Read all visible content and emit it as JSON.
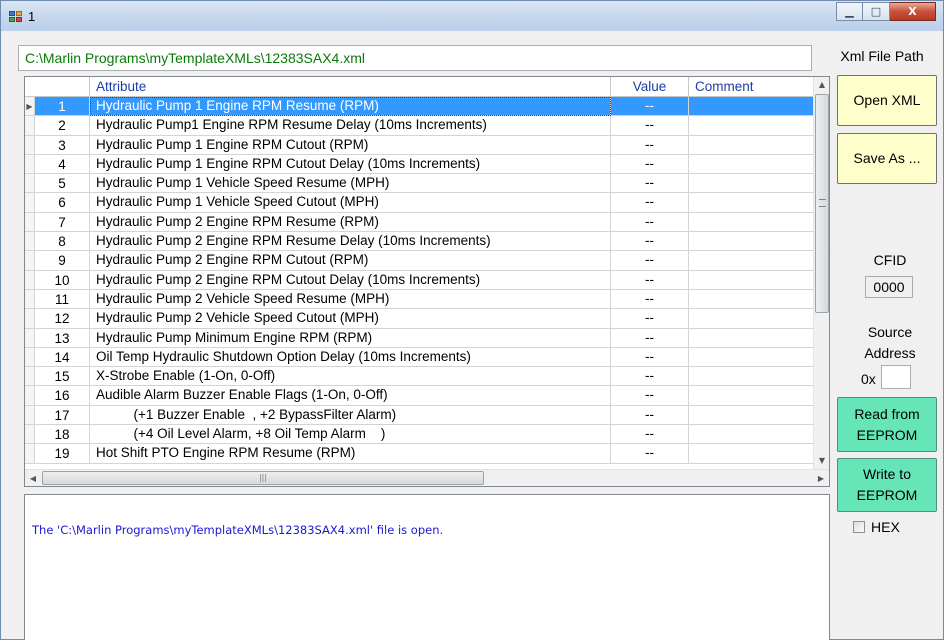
{
  "window": {
    "title": "1",
    "min_symbol": "▁",
    "max_symbol": "□",
    "close_symbol": "X"
  },
  "path": {
    "value": "C:\\Marlin Programs\\myTemplateXMLs\\12383SAX4.xml",
    "label": "Xml File Path"
  },
  "grid": {
    "columns": [
      "Attribute",
      "Value",
      "Comment"
    ],
    "selected_row": 0,
    "rows": [
      {
        "num": "1",
        "attr": "Hydraulic Pump 1 Engine RPM Resume (RPM)",
        "value": "--",
        "comment": ""
      },
      {
        "num": "2",
        "attr": "Hydraulic Pump1 Engine RPM Resume Delay (10ms Increments)",
        "value": "--",
        "comment": ""
      },
      {
        "num": "3",
        "attr": "Hydraulic Pump 1 Engine RPM Cutout (RPM)",
        "value": "--",
        "comment": ""
      },
      {
        "num": "4",
        "attr": "Hydraulic Pump 1 Engine RPM Cutout Delay (10ms Increments)",
        "value": "--",
        "comment": ""
      },
      {
        "num": "5",
        "attr": "Hydraulic Pump 1 Vehicle Speed Resume (MPH)",
        "value": "--",
        "comment": ""
      },
      {
        "num": "6",
        "attr": "Hydraulic Pump 1 Vehicle Speed Cutout (MPH)",
        "value": "--",
        "comment": ""
      },
      {
        "num": "7",
        "attr": "Hydraulic Pump 2 Engine RPM Resume (RPM)",
        "value": "--",
        "comment": ""
      },
      {
        "num": "8",
        "attr": "Hydraulic Pump 2 Engine RPM Resume Delay (10ms Increments)",
        "value": "--",
        "comment": ""
      },
      {
        "num": "9",
        "attr": "Hydraulic Pump 2 Engine RPM Cutout (RPM)",
        "value": "--",
        "comment": ""
      },
      {
        "num": "10",
        "attr": "Hydraulic Pump 2 Engine RPM Cutout Delay (10ms Increments)",
        "value": "--",
        "comment": ""
      },
      {
        "num": "11",
        "attr": "Hydraulic Pump 2 Vehicle Speed Resume (MPH)",
        "value": "--",
        "comment": ""
      },
      {
        "num": "12",
        "attr": "Hydraulic Pump 2 Vehicle Speed Cutout (MPH)",
        "value": "--",
        "comment": ""
      },
      {
        "num": "13",
        "attr": "Hydraulic Pump Minimum Engine RPM (RPM)",
        "value": "--",
        "comment": ""
      },
      {
        "num": "14",
        "attr": "Oil Temp Hydraulic Shutdown Option Delay (10ms Increments)",
        "value": "--",
        "comment": ""
      },
      {
        "num": "15",
        "attr": "X-Strobe Enable (1-On, 0-Off)",
        "value": "--",
        "comment": ""
      },
      {
        "num": "16",
        "attr": "Audible Alarm Buzzer Enable Flags (1-On, 0-Off)",
        "value": "--",
        "comment": ""
      },
      {
        "num": "17",
        "attr": "          (+1 Buzzer Enable  , +2 BypassFilter Alarm)",
        "value": "--",
        "comment": ""
      },
      {
        "num": "18",
        "attr": "          (+4 Oil Level Alarm, +8 Oil Temp Alarm    )",
        "value": "--",
        "comment": ""
      },
      {
        "num": "19",
        "attr": "Hot Shift PTO Engine RPM Resume (RPM)",
        "value": "--",
        "comment": ""
      }
    ]
  },
  "log": {
    "message": "The 'C:\\Marlin Programs\\myTemplateXMLs\\12383SAX4.xml' file is open."
  },
  "panel": {
    "open_xml": "Open XML",
    "save_as": "Save As ...",
    "cfid_label": "CFID",
    "cfid_value": "0000",
    "source_label_1": "Source",
    "source_label_2": "Address",
    "ox_prefix": "0x",
    "source_value": "",
    "read_1": "Read from",
    "read_2": "EEPROM",
    "write_1": "Write to",
    "write_2": "EEPROM",
    "hex_label": "HEX",
    "hex_checked": false
  },
  "colors": {
    "path_text": "#0a7a0a",
    "header_text": "#1a3ea8",
    "selection": "#3399ff",
    "log_text": "#1a1ad0",
    "button_yellow": "#ffffcc",
    "button_green": "#66e6b8"
  }
}
